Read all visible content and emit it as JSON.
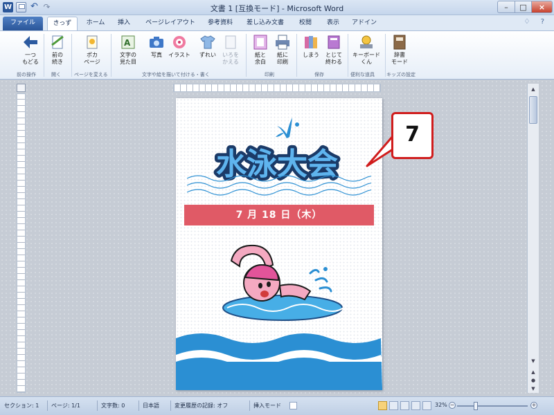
{
  "window": {
    "title": "文書 1 [互換モード] - Microsoft Word",
    "word_icon": "W",
    "undo_glyph": "↶",
    "redo_glyph": "↷",
    "minimize": "–",
    "maximize": "□",
    "close": "×"
  },
  "tabs": {
    "file": "ファイル",
    "active": "きっず",
    "items": [
      "ホーム",
      "挿入",
      "ページレイアウト",
      "参考資料",
      "差し込み文書",
      "校閲",
      "表示",
      "アドイン"
    ],
    "right_glyphs": "♢ ?"
  },
  "ribbon": {
    "buttons": [
      {
        "line1": "一つ",
        "line2": "もどる",
        "icon": "back-arrow-icon"
      },
      {
        "line1": "前の",
        "line2": "続き",
        "icon": "resume-icon"
      },
      {
        "line1": "ポカ",
        "line2": "ページ",
        "icon": "pokapage-icon"
      },
      {
        "line1": "文字の",
        "line2": "見た目",
        "icon": "text-look-icon"
      },
      {
        "line1": "写真",
        "line2": "",
        "icon": "camera-icon"
      },
      {
        "line1": "イラスト",
        "line2": "",
        "icon": "illustration-icon"
      },
      {
        "line1": "ずれい",
        "line2": "",
        "icon": "shirt-icon"
      },
      {
        "line1": "いろを",
        "line2": "かえる",
        "icon": "page-color-icon"
      },
      {
        "line1": "紙と",
        "line2": "余白",
        "icon": "paper-margin-icon"
      },
      {
        "line1": "紙に",
        "line2": "印刷",
        "icon": "print-icon"
      },
      {
        "line1": "しまう",
        "line2": "",
        "icon": "save-books-icon"
      },
      {
        "line1": "とじて",
        "line2": "終わる",
        "icon": "close-book-icon"
      },
      {
        "line1": "キーボード",
        "line2": "くん",
        "icon": "keyboard-icon"
      },
      {
        "line1": "辞書",
        "line2": "モード",
        "icon": "dictionary-icon"
      }
    ],
    "groups": [
      "前の操作",
      "開く",
      "ページを変える",
      "文字や絵を描いて付ける・書く",
      "印刷",
      "保存",
      "便利な道具",
      "キッズの設定"
    ]
  },
  "document": {
    "title": "水泳大会",
    "date": "7 月 18 日（木）"
  },
  "callout": {
    "number": "7"
  },
  "statusbar": {
    "section": "セクション: 1",
    "page": "ページ: 1/1",
    "chars": "文字数: 0",
    "language": "日本語",
    "track_changes": "変更履歴の記録: オフ",
    "insert_mode": "挿入モード",
    "zoom": "32%",
    "zoom_minus": "−",
    "zoom_plus": "+"
  },
  "colors": {
    "title_blue": "#3a8dd6",
    "wave_blue": "#2b8fd3",
    "band_red": "#e05a66",
    "callout_red": "#d01c1c"
  }
}
